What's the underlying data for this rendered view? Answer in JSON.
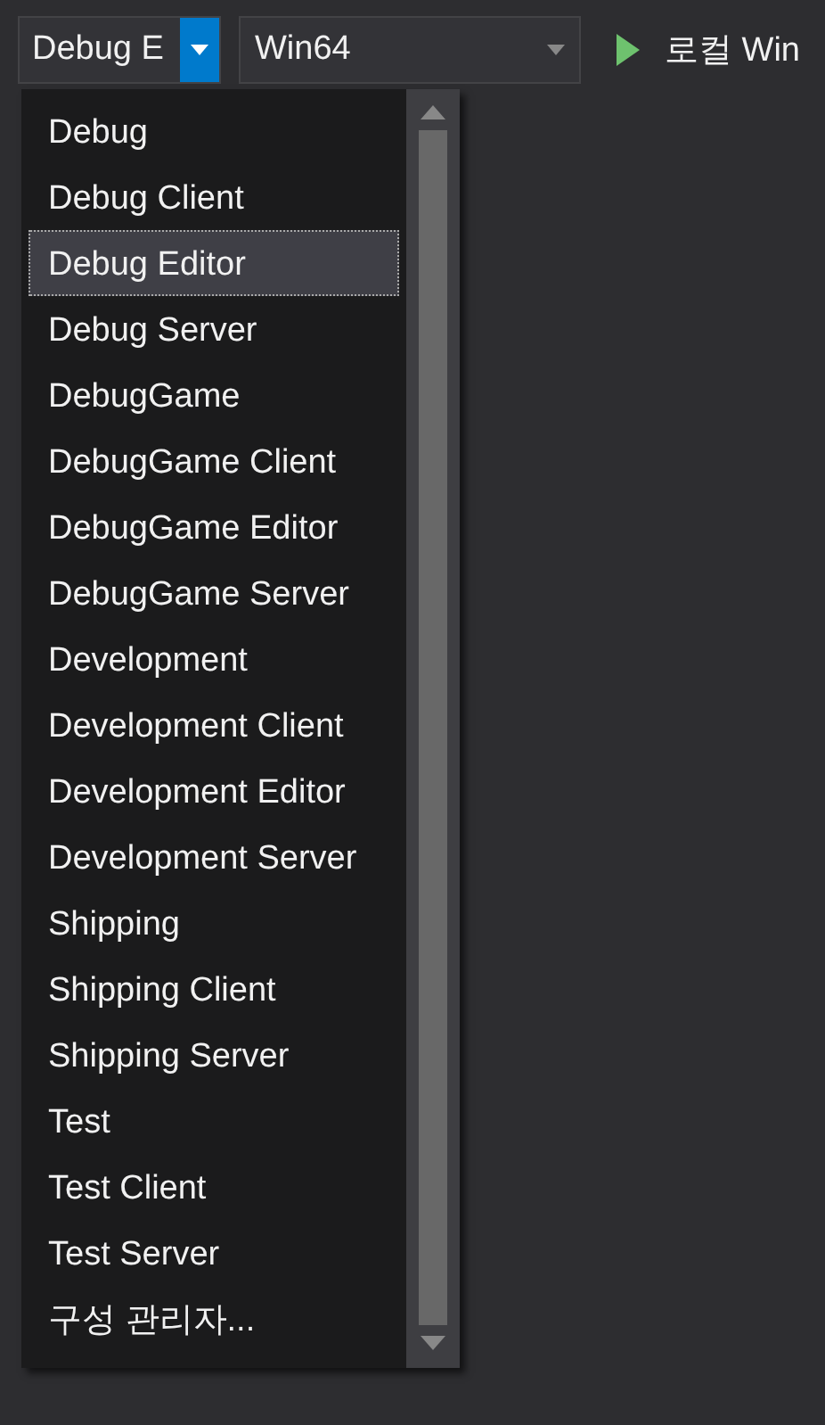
{
  "toolbar": {
    "configuration": {
      "value": "Debug E",
      "expanded": true
    },
    "platform": {
      "value": "Win64"
    },
    "run_button": {
      "label": "로컬 Win"
    }
  },
  "dropdown": {
    "items": [
      {
        "label": "Debug",
        "selected": false
      },
      {
        "label": "Debug Client",
        "selected": false
      },
      {
        "label": "Debug Editor",
        "selected": true
      },
      {
        "label": "Debug Server",
        "selected": false
      },
      {
        "label": "DebugGame",
        "selected": false
      },
      {
        "label": "DebugGame Client",
        "selected": false
      },
      {
        "label": "DebugGame Editor",
        "selected": false
      },
      {
        "label": "DebugGame Server",
        "selected": false
      },
      {
        "label": "Development",
        "selected": false
      },
      {
        "label": "Development Client",
        "selected": false
      },
      {
        "label": "Development Editor",
        "selected": false
      },
      {
        "label": "Development Server",
        "selected": false
      },
      {
        "label": "Shipping",
        "selected": false
      },
      {
        "label": "Shipping Client",
        "selected": false
      },
      {
        "label": "Shipping Server",
        "selected": false
      },
      {
        "label": "Test",
        "selected": false
      },
      {
        "label": "Test Client",
        "selected": false
      },
      {
        "label": "Test Server",
        "selected": false
      },
      {
        "label": "구성 관리자...",
        "selected": false
      }
    ]
  }
}
